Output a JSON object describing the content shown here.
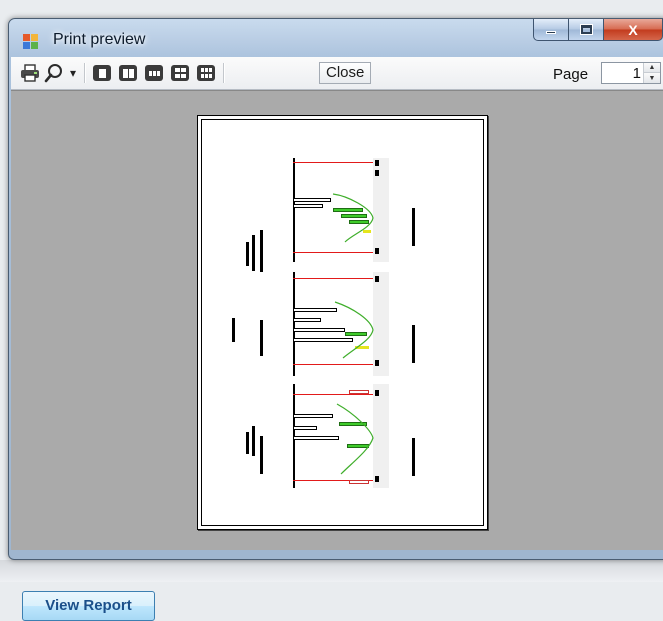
{
  "window": {
    "title": "Print preview",
    "caption_buttons": {
      "minimize_icon": "minimize-icon",
      "maximize_icon": "maximize-icon",
      "close_glyph": "X"
    }
  },
  "toolbar": {
    "print_icon": "printer-icon",
    "zoom_icon": "magnifier-icon",
    "zoom_dropdown_glyph": "▾",
    "layouts": [
      "one-page",
      "two-pages",
      "three-pages",
      "four-pages",
      "six-pages"
    ],
    "close_label": "Close",
    "page_label": "Page",
    "page_value": "1",
    "spin_up": "▲",
    "spin_down": "▼"
  },
  "preview": {
    "page_count_visible": 1,
    "charts": 3
  },
  "footer": {
    "view_report_label": "View Report"
  },
  "colors": {
    "preview_bg": "#aaaaaa",
    "spec_line": "#e21a1a",
    "histogram_green": "#3fcc2b",
    "histogram_yellow": "#e5e51d",
    "button_text": "#1b4f8a"
  }
}
